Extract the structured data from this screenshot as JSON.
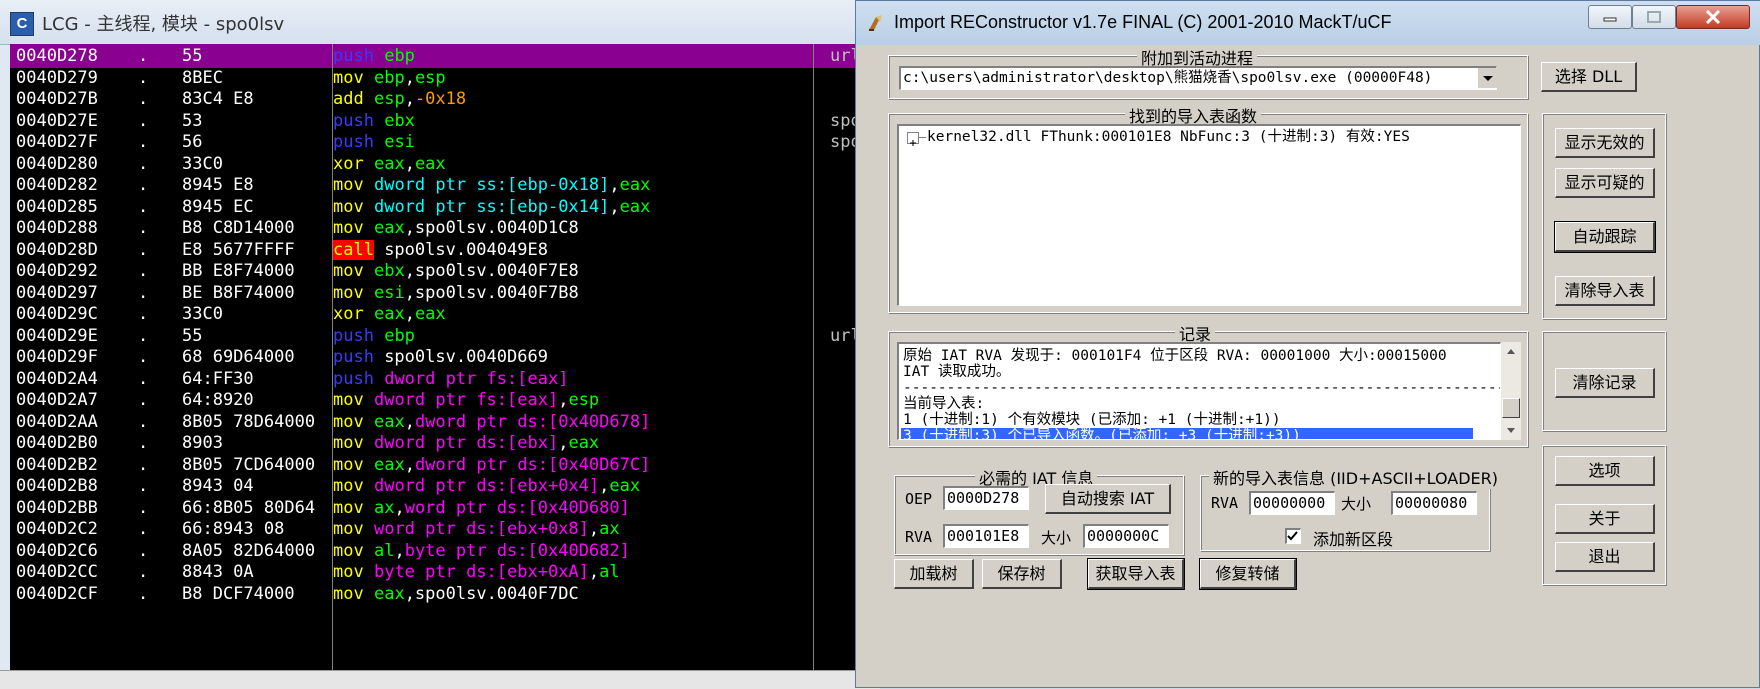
{
  "debugger": {
    "title": "LCG - 主线程, 模块 - spo0lsv",
    "icon_letter": "C",
    "rows": [
      {
        "addr": "0040D278",
        "dot": ".",
        "bytes": "55",
        "tokens": [
          [
            "push",
            "push"
          ],
          [
            " ",
            "w"
          ],
          [
            "ebp",
            "reg"
          ]
        ],
        "comment": "url"
      },
      {
        "addr": "0040D279",
        "dot": ".",
        "bytes": "8BEC",
        "tokens": [
          [
            "mov",
            "mov"
          ],
          [
            " ",
            "w"
          ],
          [
            "ebp",
            "reg"
          ],
          [
            ",",
            "w"
          ],
          [
            "esp",
            "reg"
          ]
        ],
        "comment": ""
      },
      {
        "addr": "0040D27B",
        "dot": ".",
        "bytes": "83C4 E8",
        "tokens": [
          [
            "add",
            "mov"
          ],
          [
            " ",
            "w"
          ],
          [
            "esp",
            "reg"
          ],
          [
            ",",
            "w"
          ],
          [
            "-0x18",
            "num"
          ]
        ],
        "comment": ""
      },
      {
        "addr": "0040D27E",
        "dot": ".",
        "bytes": "53",
        "tokens": [
          [
            "push",
            "push"
          ],
          [
            " ",
            "w"
          ],
          [
            "ebx",
            "reg"
          ]
        ],
        "comment": "spo"
      },
      {
        "addr": "0040D27F",
        "dot": ".",
        "bytes": "56",
        "tokens": [
          [
            "push",
            "push"
          ],
          [
            " ",
            "w"
          ],
          [
            "esi",
            "reg"
          ]
        ],
        "comment": "spo"
      },
      {
        "addr": "0040D280",
        "dot": ".",
        "bytes": "33C0",
        "tokens": [
          [
            "xor",
            "mov"
          ],
          [
            " ",
            "w"
          ],
          [
            "eax",
            "reg"
          ],
          [
            ",",
            "w"
          ],
          [
            "eax",
            "reg"
          ]
        ],
        "comment": ""
      },
      {
        "addr": "0040D282",
        "dot": ".",
        "bytes": "8945 E8",
        "tokens": [
          [
            "mov",
            "mov"
          ],
          [
            " ",
            "w"
          ],
          [
            "dword ptr ss:[ebp-0x18]",
            "mem"
          ],
          [
            ",",
            "w"
          ],
          [
            "eax",
            "reg"
          ]
        ],
        "comment": ""
      },
      {
        "addr": "0040D285",
        "dot": ".",
        "bytes": "8945 EC",
        "tokens": [
          [
            "mov",
            "mov"
          ],
          [
            " ",
            "w"
          ],
          [
            "dword ptr ss:[ebp-0x14]",
            "mem"
          ],
          [
            ",",
            "w"
          ],
          [
            "eax",
            "reg"
          ]
        ],
        "comment": ""
      },
      {
        "addr": "0040D288",
        "dot": ".",
        "bytes": "B8 C8D14000",
        "tokens": [
          [
            "mov",
            "mov"
          ],
          [
            " ",
            "w"
          ],
          [
            "eax",
            "reg"
          ],
          [
            ",spo0lsv.0040D1C8",
            "w"
          ]
        ],
        "comment": ""
      },
      {
        "addr": "0040D28D",
        "dot": ".",
        "bytes": "E8 5677FFFF",
        "tokens": [
          [
            "call",
            "call"
          ],
          [
            " spo0lsv.004049E8",
            "w"
          ]
        ],
        "comment": ""
      },
      {
        "addr": "0040D292",
        "dot": ".",
        "bytes": "BB E8F74000",
        "tokens": [
          [
            "mov",
            "mov"
          ],
          [
            " ",
            "w"
          ],
          [
            "ebx",
            "reg"
          ],
          [
            ",spo0lsv.0040F7E8",
            "w"
          ]
        ],
        "comment": ""
      },
      {
        "addr": "0040D297",
        "dot": ".",
        "bytes": "BE B8F74000",
        "tokens": [
          [
            "mov",
            "mov"
          ],
          [
            " ",
            "w"
          ],
          [
            "esi",
            "reg"
          ],
          [
            ",spo0lsv.0040F7B8",
            "w"
          ]
        ],
        "comment": ""
      },
      {
        "addr": "0040D29C",
        "dot": ".",
        "bytes": "33C0",
        "tokens": [
          [
            "xor",
            "mov"
          ],
          [
            " ",
            "w"
          ],
          [
            "eax",
            "reg"
          ],
          [
            ",",
            "w"
          ],
          [
            "eax",
            "reg"
          ]
        ],
        "comment": ""
      },
      {
        "addr": "0040D29E",
        "dot": ".",
        "bytes": "55",
        "tokens": [
          [
            "push",
            "push"
          ],
          [
            " ",
            "w"
          ],
          [
            "ebp",
            "reg"
          ]
        ],
        "comment": "url"
      },
      {
        "addr": "0040D29F",
        "dot": ".",
        "bytes": "68 69D64000",
        "tokens": [
          [
            "push",
            "push"
          ],
          [
            " spo0lsv.0040D669",
            "w"
          ]
        ],
        "comment": ""
      },
      {
        "addr": "0040D2A4",
        "dot": ".",
        "bytes": "64:FF30",
        "tokens": [
          [
            "push",
            "push"
          ],
          [
            " ",
            "w"
          ],
          [
            "dword ptr fs:[eax]",
            "fs"
          ]
        ],
        "comment": ""
      },
      {
        "addr": "0040D2A7",
        "dot": ".",
        "bytes": "64:8920",
        "tokens": [
          [
            "mov",
            "mov"
          ],
          [
            " ",
            "w"
          ],
          [
            "dword ptr fs:[eax]",
            "fs"
          ],
          [
            ",",
            "w"
          ],
          [
            "esp",
            "reg"
          ]
        ],
        "comment": ""
      },
      {
        "addr": "0040D2AA",
        "dot": ".",
        "bytes": "8B05 78D64000",
        "tokens": [
          [
            "mov",
            "mov"
          ],
          [
            " ",
            "w"
          ],
          [
            "eax",
            "reg"
          ],
          [
            ",",
            "w"
          ],
          [
            "dword ptr ds:[0x40D678]",
            "fs"
          ]
        ],
        "comment": ""
      },
      {
        "addr": "0040D2B0",
        "dot": ".",
        "bytes": "8903",
        "tokens": [
          [
            "mov",
            "mov"
          ],
          [
            " ",
            "w"
          ],
          [
            "dword ptr ds:[ebx]",
            "fs"
          ],
          [
            ",",
            "w"
          ],
          [
            "eax",
            "reg"
          ]
        ],
        "comment": ""
      },
      {
        "addr": "0040D2B2",
        "dot": ".",
        "bytes": "8B05 7CD64000",
        "tokens": [
          [
            "mov",
            "mov"
          ],
          [
            " ",
            "w"
          ],
          [
            "eax",
            "reg"
          ],
          [
            ",",
            "w"
          ],
          [
            "dword ptr ds:[0x40D67C]",
            "fs"
          ]
        ],
        "comment": ""
      },
      {
        "addr": "0040D2B8",
        "dot": ".",
        "bytes": "8943 04",
        "tokens": [
          [
            "mov",
            "mov"
          ],
          [
            " ",
            "w"
          ],
          [
            "dword ptr ds:[ebx+0x4]",
            "fs"
          ],
          [
            ",",
            "w"
          ],
          [
            "eax",
            "reg"
          ]
        ],
        "comment": ""
      },
      {
        "addr": "0040D2BB",
        "dot": ".",
        "bytes": "66:8B05 80D64",
        "tokens": [
          [
            "mov",
            "mov"
          ],
          [
            " ",
            "w"
          ],
          [
            "ax",
            "reg"
          ],
          [
            ",",
            "w"
          ],
          [
            "word ptr ds:[0x40D680]",
            "fs"
          ]
        ],
        "comment": ""
      },
      {
        "addr": "0040D2C2",
        "dot": ".",
        "bytes": "66:8943 08",
        "tokens": [
          [
            "mov",
            "mov"
          ],
          [
            " ",
            "w"
          ],
          [
            "word ptr ds:[ebx+0x8]",
            "fs"
          ],
          [
            ",",
            "w"
          ],
          [
            "ax",
            "reg"
          ]
        ],
        "comment": ""
      },
      {
        "addr": "0040D2C6",
        "dot": ".",
        "bytes": "8A05 82D64000",
        "tokens": [
          [
            "mov",
            "mov"
          ],
          [
            " ",
            "w"
          ],
          [
            "al",
            "reg"
          ],
          [
            ",",
            "w"
          ],
          [
            "byte ptr ds:[0x40D682]",
            "fs"
          ]
        ],
        "comment": ""
      },
      {
        "addr": "0040D2CC",
        "dot": ".",
        "bytes": "8843 0A",
        "tokens": [
          [
            "mov",
            "mov"
          ],
          [
            " ",
            "w"
          ],
          [
            "byte ptr ds:[ebx+0xA]",
            "fs"
          ],
          [
            ",",
            "w"
          ],
          [
            "al",
            "reg"
          ]
        ],
        "comment": ""
      },
      {
        "addr": "0040D2CF",
        "dot": ".",
        "bytes": "B8 DCF74000",
        "tokens": [
          [
            "mov",
            "mov"
          ],
          [
            " ",
            "w"
          ],
          [
            "eax",
            "reg"
          ],
          [
            ",spo0lsv.0040F7DC",
            "w"
          ]
        ],
        "comment": ""
      }
    ],
    "selected_row": 0
  },
  "irec": {
    "title": "Import REConstructor v1.7e FINAL (C) 2001-2010 MackT/uCF",
    "attach_group": "附加到活动进程",
    "process_value": "c:\\users\\administrator\\desktop\\熊猫烧香\\spo0lsv.exe (00000F48)",
    "pick_dll": "选择 DLL",
    "imports_group": "找到的导入表函数",
    "import_tree": [
      "kernel32.dll FThunk:000101E8 NbFunc:3 (十进制:3) 有效:YES"
    ],
    "show_invalid": "显示无效的",
    "show_suspect": "显示可疑的",
    "auto_trace": "自动跟踪",
    "clear_imports": "清除导入表",
    "log_group": "记录",
    "log_lines": [
      "原始 IAT RVA 发现于: 000101F4 位于区段 RVA: 00001000 大小:00015000",
      "IAT 读取成功。",
      "------------------------------------------------------------------------",
      "当前导入表:",
      "1 (十进制:1) 个有效模块 (已添加: +1 (十进制:+1))",
      "3 (十进制:3) 个已导入函数。(已添加: +3 (十进制:+3))"
    ],
    "clear_log": "清除记录",
    "iat_group": "必需的 IAT 信息",
    "oep_label": "OEP",
    "oep_value": "0000D278",
    "iat_autosearch": "自动搜索 IAT",
    "rva_label": "RVA",
    "rva_value": "000101E8",
    "size_label": "大小",
    "size_value": "0000000C",
    "new_import_group": "新的导入表信息 (IID+ASCII+LOADER)",
    "new_rva_label": "RVA",
    "new_rva_value": "00000000",
    "new_size_label": "大小",
    "new_size_value": "00000080",
    "add_section_label": "添加新区段",
    "add_section_checked": true,
    "load_tree": "加载树",
    "save_tree": "保存树",
    "get_imports": "获取导入表",
    "fix_dump": "修复转储",
    "options": "选项",
    "about": "关于",
    "exit": "退出"
  }
}
